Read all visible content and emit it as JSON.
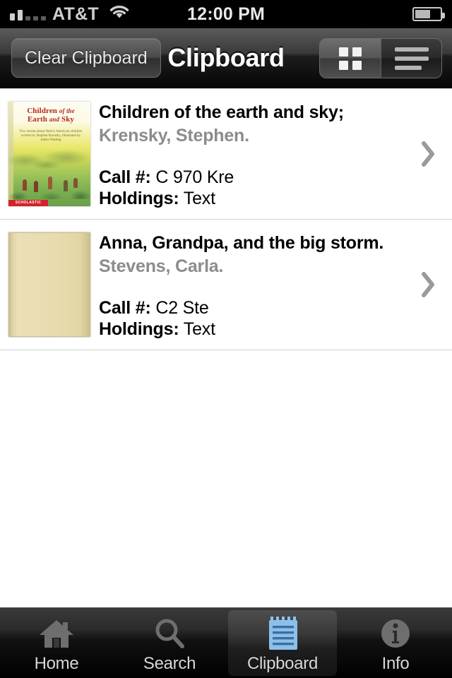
{
  "status_bar": {
    "carrier": "AT&T",
    "time": "12:00 PM",
    "signal_icon": "signal-bars-icon",
    "wifi_icon": "wifi-icon",
    "battery_icon": "battery-icon",
    "battery_level_percent": 55
  },
  "nav_bar": {
    "left_button": "Clear Clipboard",
    "title": "Clipboard",
    "segmented": [
      {
        "name": "grid-view",
        "icon": "grid-view-icon",
        "selected": true
      },
      {
        "name": "list-view",
        "icon": "list-view-icon",
        "selected": false
      }
    ]
  },
  "labels": {
    "call_number": "Call #:",
    "holdings": "Holdings:"
  },
  "list": {
    "items": [
      {
        "title": "Children of the earth and sky;",
        "author": "Krensky, Stephen.",
        "call_number": "C 970 Kre",
        "holdings": "Text",
        "cover": {
          "type": "artwork",
          "title_line1": "Children",
          "title_of": "of the",
          "title_line2": "Earth",
          "title_and": "and",
          "title_line3": "Sky",
          "subtitle": "Five stories about Native American children written by Stephen Krensky, illustrated by James Watling",
          "publisher_banner": "SCHOLASTIC"
        },
        "disclosure_icon": "chevron-right-icon"
      },
      {
        "title": "Anna, Grandpa, and the big storm.",
        "author": "Stevens, Carla.",
        "call_number": "C2 Ste",
        "holdings": "Text",
        "cover": {
          "type": "placeholder"
        },
        "disclosure_icon": "chevron-right-icon"
      }
    ]
  },
  "tab_bar": {
    "tabs": [
      {
        "label": "Home",
        "icon": "home-icon",
        "selected": false
      },
      {
        "label": "Search",
        "icon": "search-icon",
        "selected": false
      },
      {
        "label": "Clipboard",
        "icon": "clipboard-icon",
        "selected": true
      },
      {
        "label": "Info",
        "icon": "info-icon",
        "selected": false
      }
    ]
  },
  "colors": {
    "accent": "#8cc0ea",
    "nav_background": "#1d1d1d",
    "author_text": "#8c8c8c",
    "separator": "#d2d2d2"
  }
}
